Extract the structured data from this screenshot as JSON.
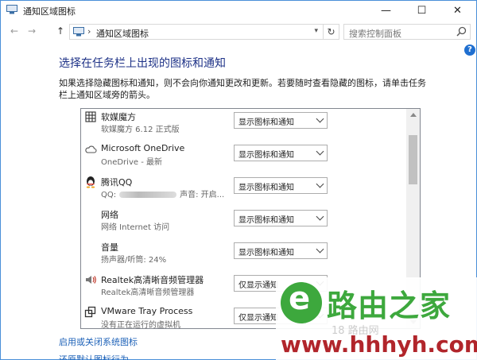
{
  "window": {
    "title": "通知区域图标",
    "minimize": "—",
    "maximize": "☐",
    "close": "✕"
  },
  "address": {
    "back": "←",
    "forward": "→",
    "up": "↑",
    "separator": "›",
    "crumb": "通知区域图标",
    "refresh": "↻",
    "search_placeholder": "搜索控制面板"
  },
  "page": {
    "heading": "选择在任务栏上出现的图标和通知",
    "description": "如果选择隐藏图标和通知，则不会向你通知更改和更新。若要随时查看隐藏的图标，请单击任务栏上通知区域旁的箭头。",
    "help": "?"
  },
  "icons": [
    {
      "name": "软媒魔方",
      "subtitle": "软媒魔方 6.12 正式版",
      "behavior": "显示图标和通知",
      "icon": "grid-icon"
    },
    {
      "name": "Microsoft OneDrive",
      "subtitle": "OneDrive - 最新",
      "behavior": "显示图标和通知",
      "icon": "cloud-icon"
    },
    {
      "name": "腾讯QQ",
      "subtitle_prefix": "QQ:",
      "subtitle_suffix": "声音: 开启...",
      "behavior": "显示图标和通知",
      "icon": "qq-penguin-icon"
    },
    {
      "name": "网络",
      "subtitle": "网络 Internet 访问",
      "behavior": "显示图标和通知",
      "icon": "network-icon"
    },
    {
      "name": "音量",
      "subtitle": "扬声器/听筒: 24%",
      "behavior": "显示图标和通知",
      "icon": "volume-icon"
    },
    {
      "name": "Realtek高清晰音频管理器",
      "subtitle": "Realtek高清晰音频管理器",
      "behavior": "仅显示通知",
      "icon": "speaker-icon"
    },
    {
      "name": "VMware Tray Process",
      "subtitle": "没有正在运行的虚拟机",
      "behavior": "仅显示通知",
      "icon": "vmware-icon"
    }
  ],
  "links": {
    "toggle_system_icons": "启用或关闭系统图标",
    "restore_defaults": "还原默认图标行为"
  },
  "watermark": {
    "brand": "路由之家",
    "ghost": "18 路由网",
    "url": "www.hhhyh.com"
  },
  "colors": {
    "heading": "#1e3287",
    "link": "#1e62b8",
    "brand_green": "#3da83d",
    "url_red": "#b1252b"
  }
}
